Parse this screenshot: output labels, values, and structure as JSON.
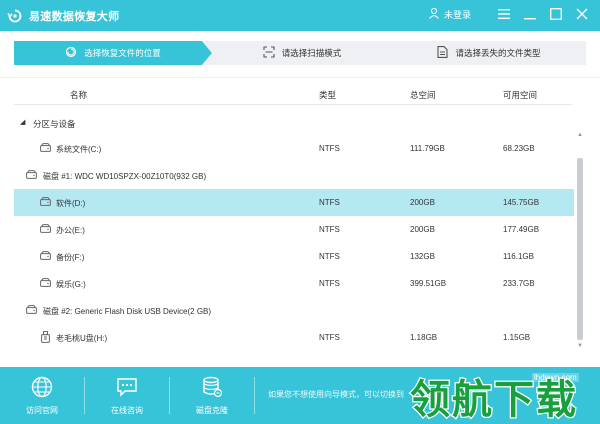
{
  "titlebar": {
    "title": "易速数据恢复大师",
    "user_label": "未登录"
  },
  "steps": [
    {
      "label": "选择恢复文件的位置",
      "icon": "location-icon"
    },
    {
      "label": "请选择扫描模式",
      "icon": "scan-icon"
    },
    {
      "label": "请选择丢失的文件类型",
      "icon": "document-icon"
    }
  ],
  "table": {
    "columns": [
      "名称",
      "类型",
      "总空间",
      "可用空间"
    ],
    "section_title": "分区与设备",
    "rows": [
      {
        "kind": "partition",
        "name": "系统文件(C:)",
        "type": "NTFS",
        "total": "111.79GB",
        "free": "68.23GB"
      },
      {
        "kind": "disk",
        "name": "磁盘 #1: WDC WD10SPZX-00Z10T0(932 GB)"
      },
      {
        "kind": "partition",
        "name": "软件(D:)",
        "type": "NTFS",
        "total": "200GB",
        "free": "145.75GB",
        "selected": true
      },
      {
        "kind": "partition",
        "name": "办公(E:)",
        "type": "NTFS",
        "total": "200GB",
        "free": "177.49GB"
      },
      {
        "kind": "partition",
        "name": "备份(F:)",
        "type": "NTFS",
        "total": "132GB",
        "free": "116.1GB"
      },
      {
        "kind": "partition",
        "name": "娱乐(G:)",
        "type": "NTFS",
        "total": "399.51GB",
        "free": "233.7GB"
      },
      {
        "kind": "disk",
        "name": "磁盘 #2: Generic Flash Disk USB Device(2 GB)"
      },
      {
        "kind": "usb",
        "name": "老毛桃U盘(H:)",
        "type": "NTFS",
        "total": "1.18GB",
        "free": "1.15GB"
      }
    ]
  },
  "footer": {
    "buttons": [
      {
        "label": "访问官网",
        "icon": "globe-icon"
      },
      {
        "label": "在线咨询",
        "icon": "chat-icon"
      },
      {
        "label": "磁盘克隆",
        "icon": "database-icon"
      }
    ],
    "hint": "如果您不想使用向导模式，可以切换到"
  },
  "watermark": {
    "url": "lhdown.com",
    "text": "领航下载"
  },
  "colors": {
    "accent": "#38c4d8",
    "selected_row": "#b4e9f2"
  }
}
